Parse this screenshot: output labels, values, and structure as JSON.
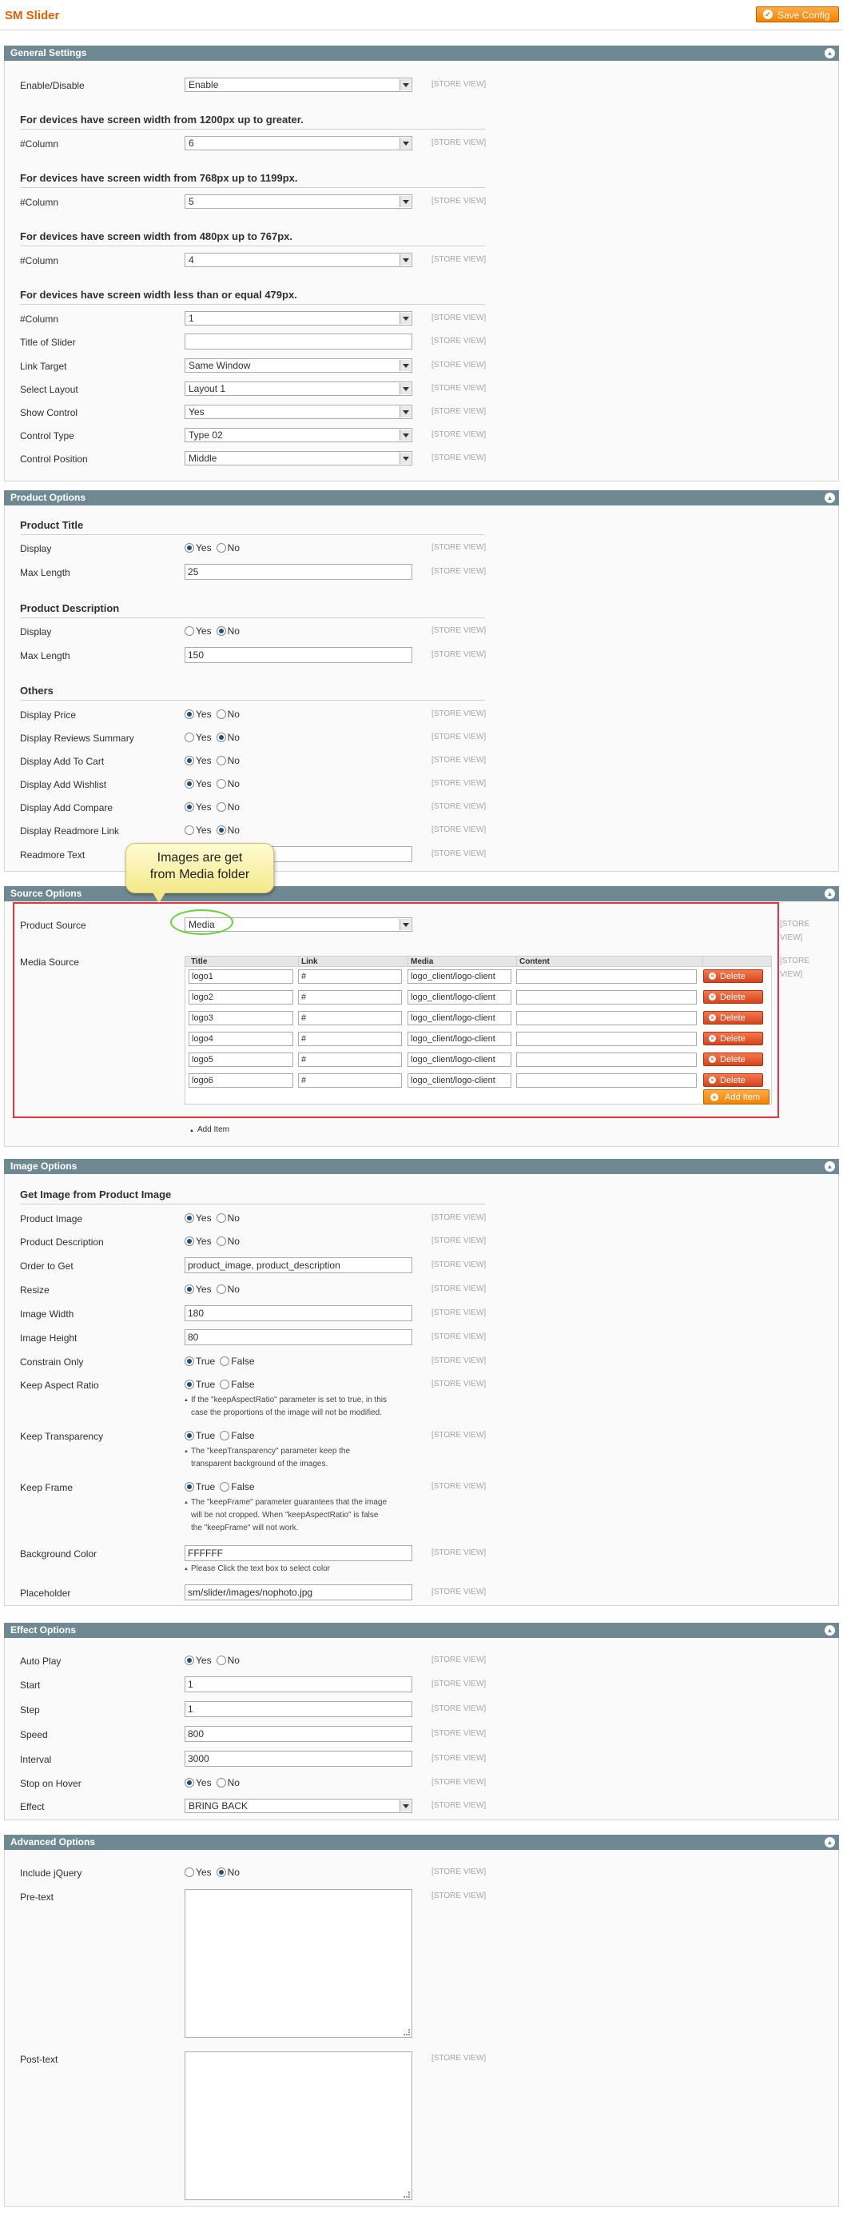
{
  "header": {
    "title": "SM Slider",
    "save_label": "Save Config"
  },
  "store_view": "[STORE VIEW]",
  "store_view_split": [
    "[STORE",
    "VIEW]"
  ],
  "general": {
    "title": "General Settings",
    "enable_label": "Enable/Disable",
    "enable_value": "Enable",
    "h1200": "For devices have screen width from 1200px up to greater.",
    "h768": "For devices have screen width from 768px up to 1199px.",
    "h480": "For devices have screen width from 480px up to 767px.",
    "h479": "For devices have screen width less than or equal 479px.",
    "column_label": "#Column",
    "col1200": "6",
    "col768": "5",
    "col480": "4",
    "col479": "1",
    "title_label": "Title of Slider",
    "title_value": "",
    "link_target_label": "Link Target",
    "link_target_value": "Same Window",
    "layout_label": "Select Layout",
    "layout_value": "Layout 1",
    "show_control_label": "Show Control",
    "show_control_value": "Yes",
    "control_type_label": "Control Type",
    "control_type_value": "Type 02",
    "control_position_label": "Control Position",
    "control_position_value": "Middle"
  },
  "product": {
    "title": "Product Options",
    "h_title": "Product Title",
    "display_label": "Display",
    "maxlen_label": "Max Length",
    "title_maxlen": "25",
    "h_desc": "Product Description",
    "desc_maxlen": "150",
    "h_others": "Others",
    "price_label": "Display Price",
    "reviews_label": "Display Reviews Summary",
    "cart_label": "Display Add To Cart",
    "wishlist_label": "Display Add Wishlist",
    "compare_label": "Display Add Compare",
    "readmore_link_label": "Display Readmore Link",
    "readmore_text_label": "Readmore Text",
    "readmore_text_value": ""
  },
  "radio": {
    "yes": "Yes",
    "no": "No",
    "true": "True",
    "false": "False"
  },
  "callout": {
    "line1": "Images are get",
    "line2": "from Media folder"
  },
  "source": {
    "title": "Source Options",
    "product_source_label": "Product Source",
    "product_source_value": "Media",
    "media_source_label": "Media Source",
    "columns": [
      "Title",
      "Link",
      "Media",
      "Content"
    ],
    "rows": [
      {
        "title": "logo1",
        "link": "#",
        "media": "logo_client/logo-client",
        "content": ""
      },
      {
        "title": "logo2",
        "link": "#",
        "media": "logo_client/logo-client",
        "content": ""
      },
      {
        "title": "logo3",
        "link": "#",
        "media": "logo_client/logo-client",
        "content": ""
      },
      {
        "title": "logo4",
        "link": "#",
        "media": "logo_client/logo-client",
        "content": ""
      },
      {
        "title": "logo5",
        "link": "#",
        "media": "logo_client/logo-client",
        "content": ""
      },
      {
        "title": "logo6",
        "link": "#",
        "media": "logo_client/logo-client",
        "content": ""
      }
    ],
    "delete_label": "Delete",
    "add_item_button": "Add Item",
    "add_item_link": "Add Item"
  },
  "image": {
    "title": "Image Options",
    "h_get": "Get Image from Product Image",
    "product_image_label": "Product Image",
    "product_desc_label": "Product Description",
    "order_label": "Order to Get",
    "order_value": "product_image, product_description",
    "resize_label": "Resize",
    "width_label": "Image Width",
    "width_value": "180",
    "height_label": "Image Height",
    "height_value": "80",
    "constrain_label": "Constrain Only",
    "aspect_label": "Keep Aspect Ratio",
    "aspect_note": [
      "If the \"keepAspectRatio\" parameter is set to true, in this",
      "case the proportions of the image will not be modified."
    ],
    "transp_label": "Keep Transparency",
    "transp_note": [
      "The \"keepTransparency\" parameter keep the",
      "transparent background of the images."
    ],
    "frame_label": "Keep Frame",
    "frame_note": [
      "The \"keepFrame\" parameter guarantees that the image",
      "will be not cropped. When \"keepAspectRatio\" is false",
      "the \"keepFrame\" will not work."
    ],
    "bg_label": "Background Color",
    "bg_value": "FFFFFF",
    "bg_note": "Please Click the text box to select color",
    "placeholder_label": "Placeholder",
    "placeholder_value": "sm/slider/images/nophoto.jpg"
  },
  "effect": {
    "title": "Effect Options",
    "autoplay_label": "Auto Play",
    "start_label": "Start",
    "start_value": "1",
    "step_label": "Step",
    "step_value": "1",
    "speed_label": "Speed",
    "speed_value": "800",
    "interval_label": "Interval",
    "interval_value": "3000",
    "hover_label": "Stop on Hover",
    "effect_label": "Effect",
    "effect_value": "BRING BACK"
  },
  "advanced": {
    "title": "Advanced Options",
    "jquery_label": "Include jQuery",
    "pretext_label": "Pre-text",
    "posttext_label": "Post-text"
  },
  "colors": {
    "accent": "#eb5e00",
    "section_header": "#6f8992",
    "highlight_box": "#e5363b",
    "highlight_oval": "#6ad138"
  },
  "icons": {
    "save": "check-circle-icon",
    "collapse": "chevron-up-icon",
    "delete": "x-circle-icon",
    "add": "plus-circle-icon"
  }
}
